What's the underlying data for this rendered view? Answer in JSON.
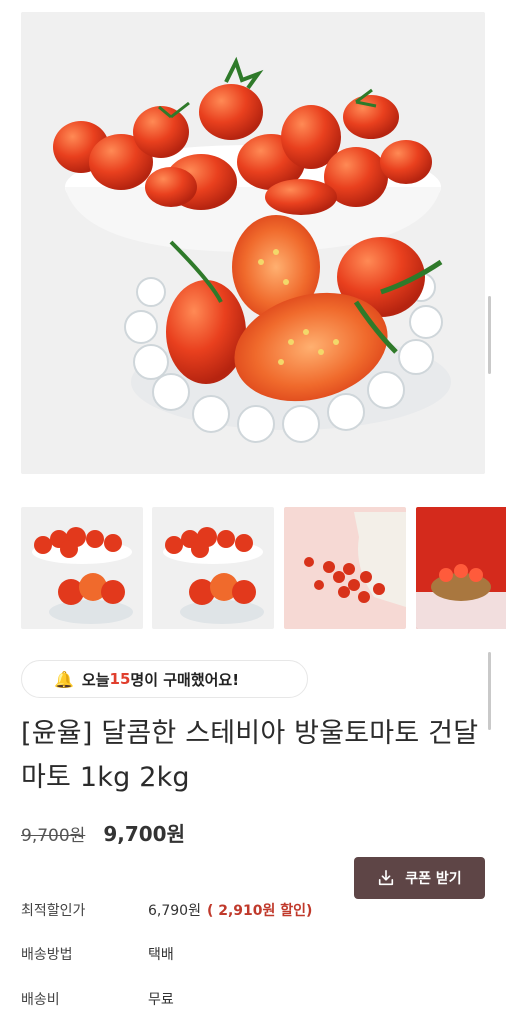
{
  "images": {
    "main": "product-main-photo",
    "thumbnails": [
      "thumb-1",
      "thumb-2",
      "thumb-3",
      "thumb-4"
    ]
  },
  "purchase_badge": {
    "icon": "bell-icon",
    "prefix": "오늘 ",
    "count": "15",
    "suffix": "명이 구매했어요!"
  },
  "product": {
    "title": "[윤율] 달콤한 스테비아 방울토마토 건달마토 1kg 2kg",
    "price_original": "9,700원",
    "price_sale": "9,700원"
  },
  "coupon": {
    "label": "쿠폰 받기",
    "icon": "download-icon"
  },
  "info": {
    "best_price_label": "최적할인가",
    "best_price_value": "6,790원",
    "best_price_discount": "( 2,910원 할인)",
    "shipping_method_label": "배송방법",
    "shipping_method_value": "택배",
    "shipping_fee_label": "배송비",
    "shipping_fee_value": "무료"
  },
  "colors": {
    "coupon_bg": "#5e4546",
    "discount_red": "#c0392b",
    "count_red": "#e03e2d",
    "tomato": "#e2391c"
  }
}
